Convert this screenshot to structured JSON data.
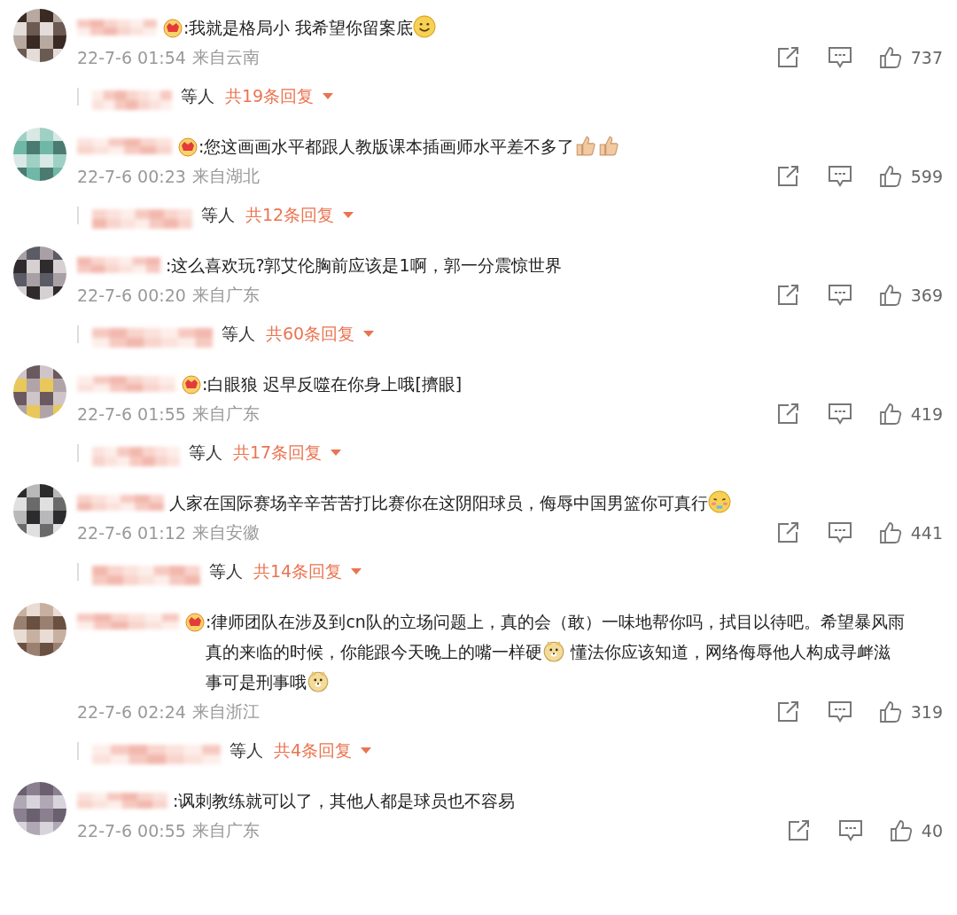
{
  "comments": [
    {
      "badge": true,
      "content": [
        {
          "kind": "text",
          "text": ":我就是格局小 我希望你留案底"
        },
        {
          "kind": "smile"
        }
      ],
      "time": "22-7-6 01:54",
      "location": "来自云南",
      "likes": "737",
      "replies": {
        "suffix": "等人",
        "count": "共19条回复"
      }
    },
    {
      "badge": true,
      "content": [
        {
          "kind": "text",
          "text": ":您这画画水平都跟人教版课本插画师水平差不多了"
        },
        {
          "kind": "thumbs"
        },
        {
          "kind": "thumbs"
        }
      ],
      "time": "22-7-6 00:23",
      "location": "来自湖北",
      "likes": "599",
      "replies": {
        "suffix": "等人",
        "count": "共12条回复"
      }
    },
    {
      "badge": false,
      "content": [
        {
          "kind": "text",
          "text": ":这么喜欢玩?郭艾伦胸前应该是1啊，郭一分震惊世界"
        }
      ],
      "time": "22-7-6 00:20",
      "location": "来自广东",
      "likes": "369",
      "replies": {
        "suffix": "等人",
        "count": "共60条回复"
      }
    },
    {
      "badge": true,
      "content": [
        {
          "kind": "text",
          "text": ":白眼狼 迟早反噬在你身上哦[擠眼]"
        }
      ],
      "time": "22-7-6 01:55",
      "location": "来自广东",
      "likes": "419",
      "replies": {
        "suffix": "等人",
        "count": "共17条回复"
      }
    },
    {
      "badge": false,
      "content": [
        {
          "kind": "text",
          "text": "人家在国际赛场辛辛苦苦打比赛你在这阴阳球员，侮辱中国男篮你可真行"
        },
        {
          "kind": "blush"
        }
      ],
      "time": "22-7-6 01:12",
      "location": "来自安徽",
      "likes": "441",
      "replies": {
        "suffix": "等人",
        "count": "共14条回复"
      }
    },
    {
      "badge": true,
      "content": [
        {
          "kind": "text",
          "text": ":律师团队在涉及到cn队的立场问题上，真的会（敢）一味地帮你吗，拭目以待吧。希望暴风雨真的来临的时候，你能跟今天晚上的嘴一样硬"
        },
        {
          "kind": "doge"
        },
        {
          "kind": "text",
          "text": " 懂法你应该知道，网络侮辱他人构成寻衅滋事可是刑事哦"
        },
        {
          "kind": "doge"
        }
      ],
      "time": "22-7-6 02:24",
      "location": "来自浙江",
      "likes": "319",
      "replies": {
        "suffix": "等人",
        "count": "共4条回复"
      }
    },
    {
      "badge": false,
      "content": [
        {
          "kind": "text",
          "text": ":讽刺教练就可以了，其他人都是球员也不容易"
        }
      ],
      "time": "22-7-6 00:55",
      "location": "来自广东",
      "likes": "40"
    }
  ]
}
